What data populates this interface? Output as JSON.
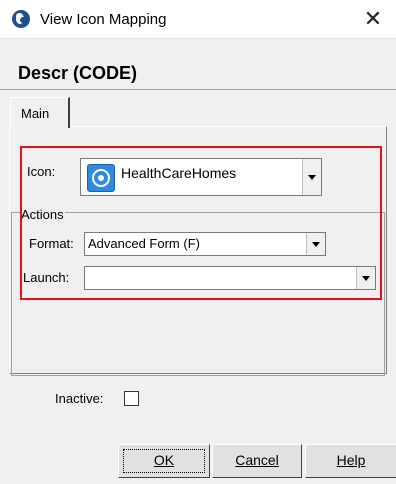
{
  "window": {
    "title": "View Icon Mapping",
    "app_icon": "globe-app-icon",
    "close_glyph": "✕"
  },
  "header": {
    "descr": "Descr (CODE)"
  },
  "tabs": [
    {
      "label": "Main",
      "selected": true
    }
  ],
  "form": {
    "icon": {
      "label": "Icon:",
      "value": "HealthCareHomes",
      "icon_name": "healthcarehomes-icon"
    },
    "actions": {
      "group_label": "Actions",
      "format_label": "Format:",
      "format_value": "Advanced Form (F)",
      "launch_label": "Launch:",
      "launch_value": ""
    },
    "inactive": {
      "label": "Inactive:",
      "checked": false
    }
  },
  "buttons": {
    "ok": "OK",
    "cancel": "Cancel",
    "help": "Help"
  },
  "highlight_color": "#e0101c"
}
